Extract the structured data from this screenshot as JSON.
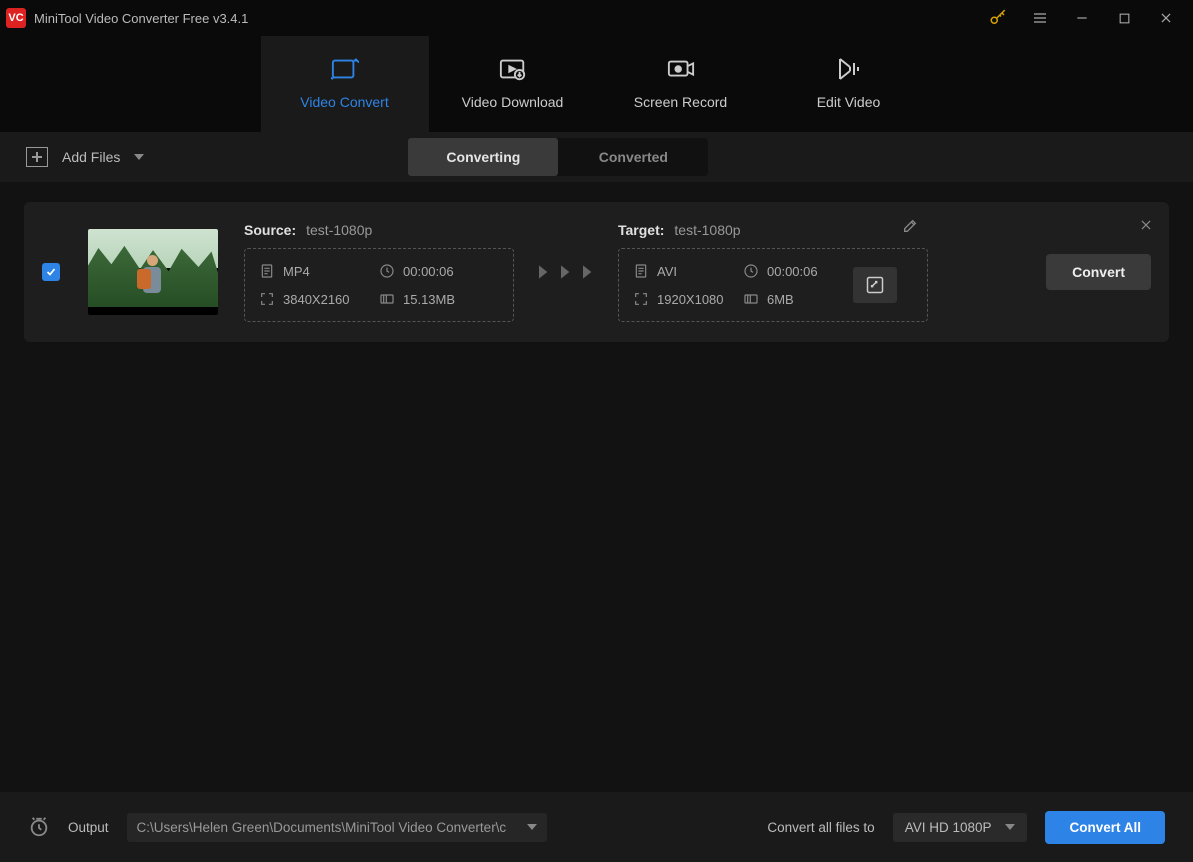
{
  "app": {
    "title": "MiniTool Video Converter Free v3.4.1"
  },
  "maintabs": {
    "convert": "Video Convert",
    "download": "Video Download",
    "record": "Screen Record",
    "edit": "Edit Video"
  },
  "toolbar": {
    "add_files": "Add Files",
    "seg_converting": "Converting",
    "seg_converted": "Converted"
  },
  "item": {
    "source_label": "Source:",
    "source_name": "test-1080p",
    "target_label": "Target:",
    "target_name": "test-1080p",
    "src_format": "MP4",
    "src_duration": "00:00:06",
    "src_resolution": "3840X2160",
    "src_size": "15.13MB",
    "tgt_format": "AVI",
    "tgt_duration": "00:00:06",
    "tgt_resolution": "1920X1080",
    "tgt_size": "6MB",
    "convert_btn": "Convert"
  },
  "bottom": {
    "output": "Output",
    "output_path": "C:\\Users\\Helen Green\\Documents\\MiniTool Video Converter\\c",
    "convert_all_to": "Convert all files to",
    "format": "AVI HD 1080P",
    "convert_all": "Convert All"
  }
}
